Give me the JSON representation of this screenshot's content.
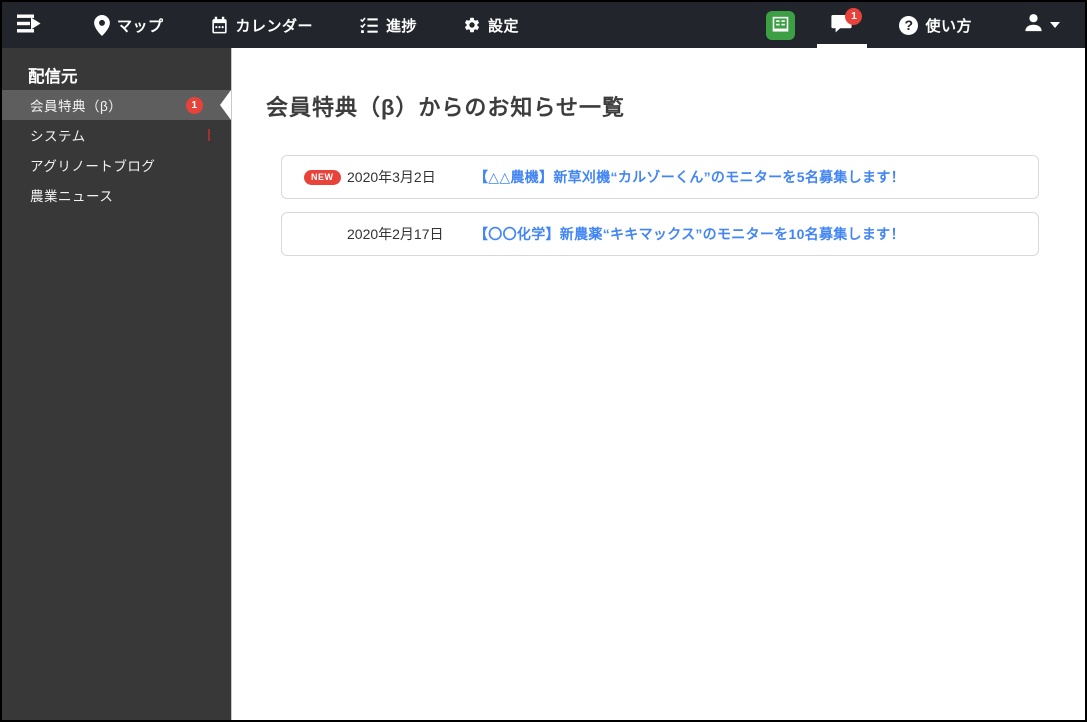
{
  "topbar": {
    "nav": [
      {
        "label": "マップ",
        "icon": "map-pin-icon"
      },
      {
        "label": "カレンダー",
        "icon": "calendar-icon"
      },
      {
        "label": "進捗",
        "icon": "progress-checklist-icon"
      },
      {
        "label": "設定",
        "icon": "gear-icon"
      }
    ],
    "notification_badge": "1",
    "help_glyph": "?",
    "help_label": "使い方"
  },
  "sidebar": {
    "header": "配信元",
    "items": [
      {
        "label": "会員特典（β）",
        "badge": "1",
        "selected": true
      },
      {
        "label": "システム"
      },
      {
        "label": "アグリノートブログ"
      },
      {
        "label": "農業ニュース"
      }
    ]
  },
  "main": {
    "title": "会員特典（β）からのお知らせ一覧",
    "notifications": [
      {
        "new_label": "NEW",
        "date": "2020年3月2日",
        "link": "【△△農機】新草刈機“カルゾーくん”のモニターを5名募集します！"
      },
      {
        "new_label": "",
        "date": "2020年2月17日",
        "link": "【〇〇化学】新農薬“キキマックス”のモニターを10名募集します！"
      }
    ]
  },
  "colors": {
    "topbar_bg": "#22262c",
    "sidebar_bg": "#383838",
    "sidebar_selected_bg": "#5e5e5e",
    "badge_red": "#e8433b",
    "link_blue": "#4285f4",
    "book_green": "#3d9f43"
  }
}
